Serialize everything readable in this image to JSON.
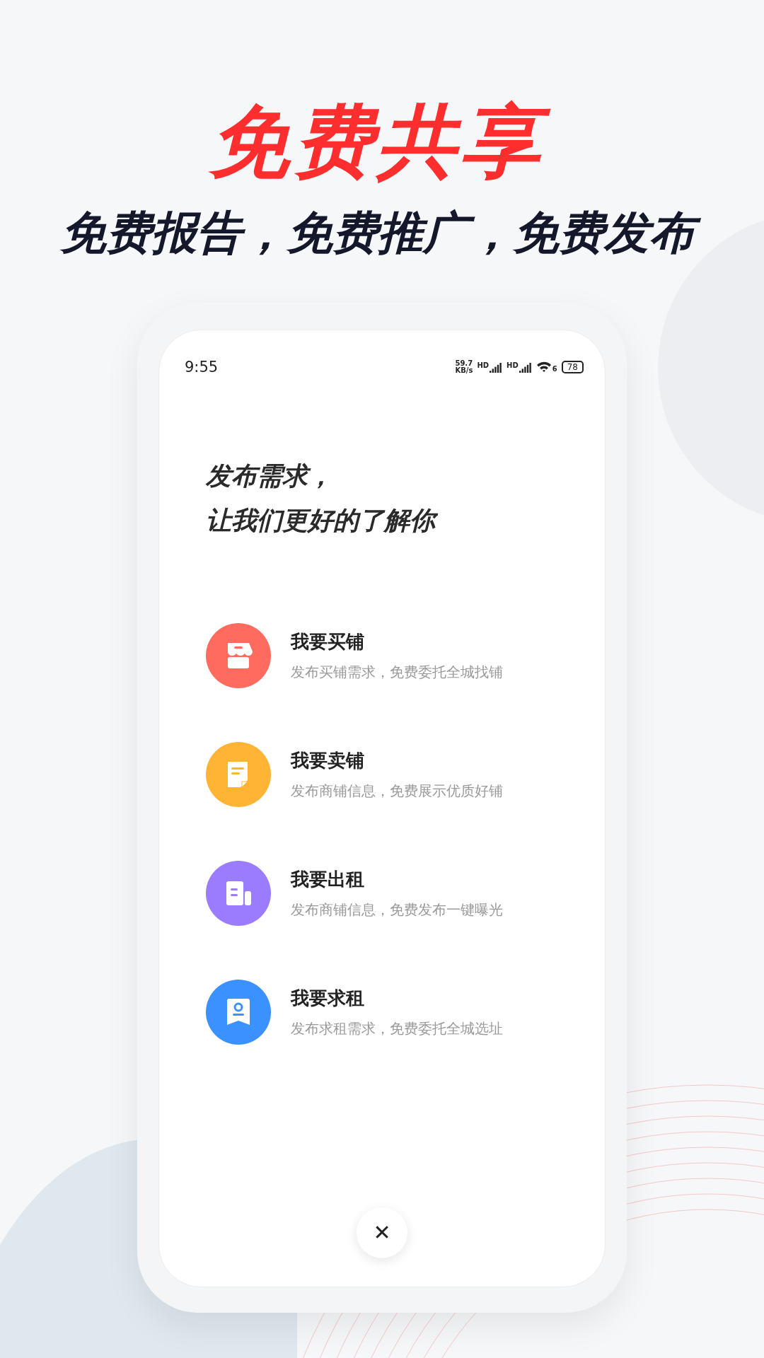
{
  "headline": "免费共享",
  "subheadline": "免费报告，免费推广，免费发布",
  "status_bar": {
    "time": "9:55",
    "speed": "59.7",
    "speed_unit": "KB/s",
    "sims": [
      {
        "badge": "HD"
      },
      {
        "badge": "HD"
      }
    ],
    "wifi_badge": "6",
    "battery": "78"
  },
  "intro": [
    "发布需求，",
    "让我们更好的了解你"
  ],
  "options": [
    {
      "kind": "shop",
      "color": "#ff6b5e",
      "title": "我要买铺",
      "subtitle": "发布买铺需求，免费委托全城找铺"
    },
    {
      "kind": "document",
      "color": "#ffb436",
      "title": "我要卖铺",
      "subtitle": "发布商铺信息，免费展示优质好铺"
    },
    {
      "kind": "building",
      "color": "#9b7cff",
      "title": "我要出租",
      "subtitle": "发布商铺信息，免费发布一键曝光"
    },
    {
      "kind": "profile",
      "color": "#3b91ff",
      "title": "我要求租",
      "subtitle": "发布求租需求，免费委托全城选址"
    }
  ],
  "close_button": "✕"
}
